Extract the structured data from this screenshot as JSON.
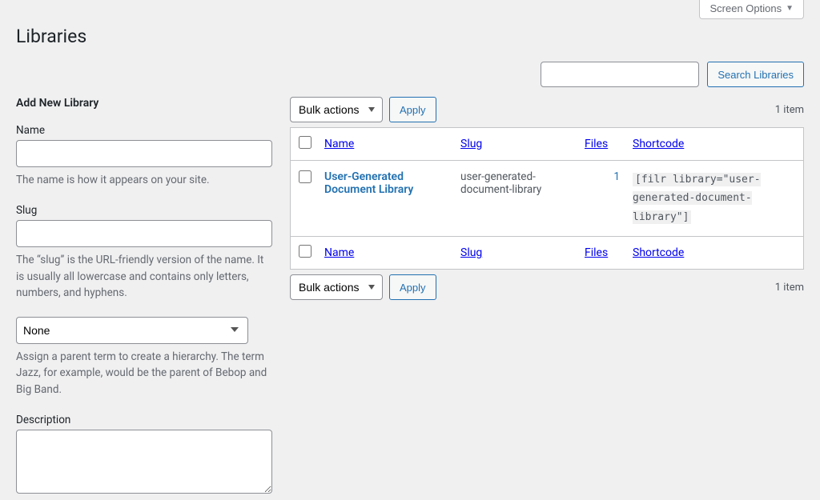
{
  "screen_options_label": "Screen Options",
  "page_title": "Libraries",
  "search": {
    "button_label": "Search Libraries"
  },
  "form": {
    "heading": "Add New Library",
    "name_label": "Name",
    "name_help": "The name is how it appears on your site.",
    "slug_label": "Slug",
    "slug_help": "The “slug” is the URL-friendly version of the name. It is usually all lowercase and contains only letters, numbers, and hyphens.",
    "parent_selected": "None",
    "parent_help": "Assign a parent term to create a hierarchy. The term Jazz, for example, would be the parent of Bebop and Big Band.",
    "description_label": "Description"
  },
  "bulk": {
    "selected": "Bulk actions",
    "apply_label": "Apply"
  },
  "item_count": "1 item",
  "columns": {
    "name": "Name",
    "slug": "Slug",
    "files": "Files",
    "shortcode": "Shortcode"
  },
  "rows": [
    {
      "name": "User-Generated Document Library",
      "slug": "user-generated-document-library",
      "files": "1",
      "shortcode": "[filr library=\"user-generated-document-library\"]"
    }
  ]
}
